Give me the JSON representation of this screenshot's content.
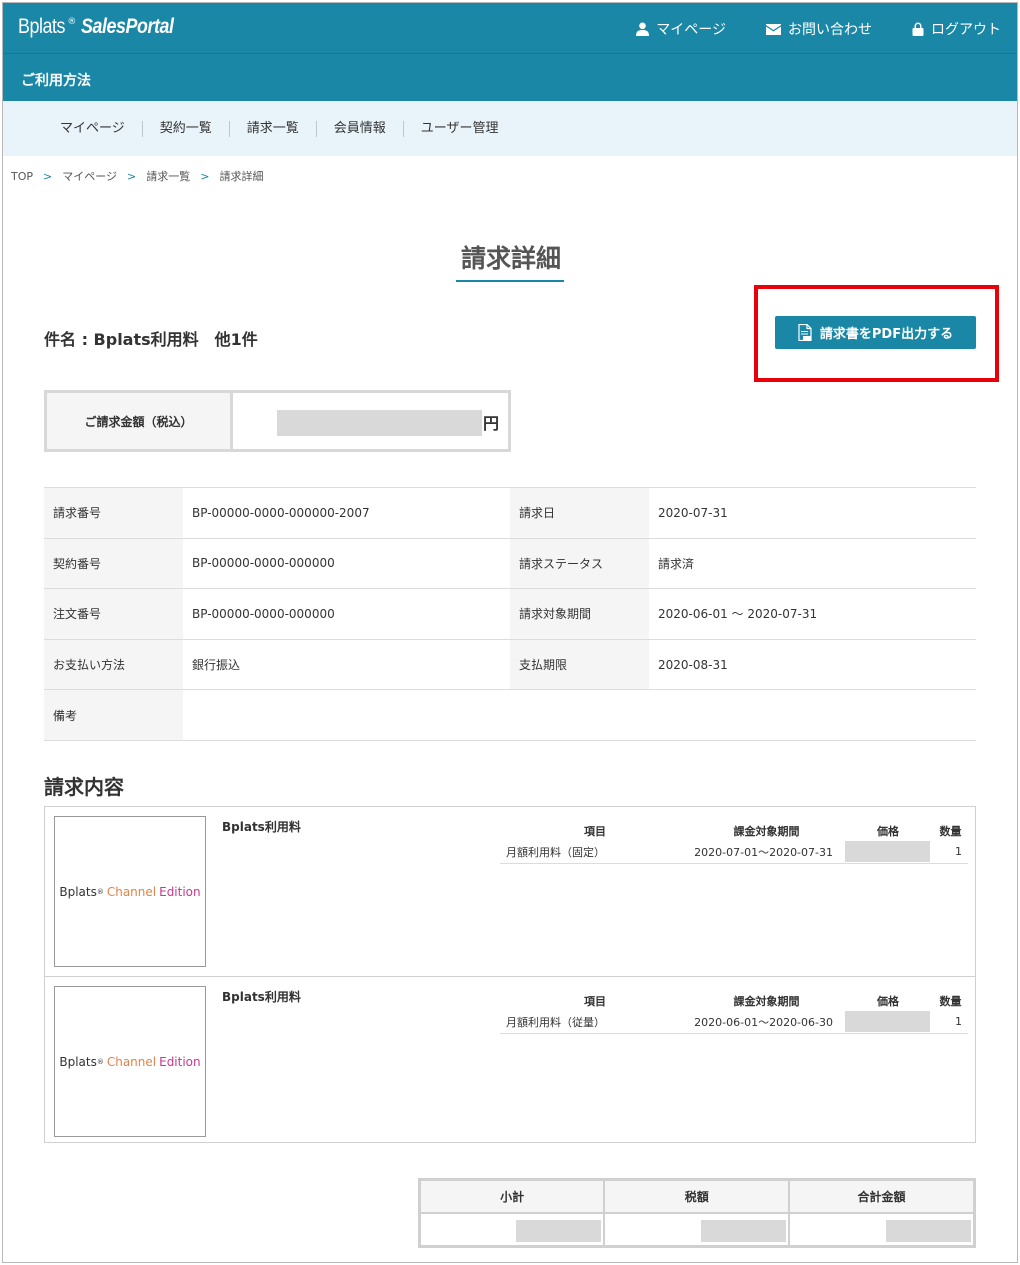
{
  "header": {
    "brand": "Bplats",
    "brand_mark": "®",
    "product": "SalesPortal",
    "nav": [
      {
        "label": "マイページ",
        "icon": "user-icon"
      },
      {
        "label": "お問い合わせ",
        "icon": "mail-icon"
      },
      {
        "label": "ログアウト",
        "icon": "lock-icon"
      }
    ],
    "help_label": "ご利用方法"
  },
  "menu": [
    "マイページ",
    "契約一覧",
    "請求一覧",
    "会員情報",
    "ユーザー管理"
  ],
  "breadcrumb": [
    "TOP",
    "マイページ",
    "請求一覧",
    "請求詳細"
  ],
  "page_title": "請求詳細",
  "subject": "件名 : Bplats利用料　他1件",
  "pdf_button_label": "請求書をPDF出力する",
  "amount": {
    "label": "ご請求金額（税込）",
    "currency": "円"
  },
  "details": [
    {
      "k1": "請求番号",
      "v1": "BP-00000-0000-000000-2007",
      "k2": "請求日",
      "v2": "2020-07-31"
    },
    {
      "k1": "契約番号",
      "v1": "BP-00000-0000-000000",
      "k2": "請求ステータス",
      "v2": "請求済"
    },
    {
      "k1": "注文番号",
      "v1": "BP-00000-0000-000000",
      "k2": "請求対象期間",
      "v2": "2020-06-01 ～ 2020-07-31"
    },
    {
      "k1": "お支払い方法",
      "v1": "銀行振込",
      "k2": "支払期限",
      "v2": "2020-08-31"
    },
    {
      "k1": "備考",
      "v1": "",
      "k2": "",
      "v2": ""
    }
  ],
  "section_title": "請求内容",
  "item_headers": {
    "item": "項目",
    "period": "課金対象期間",
    "price": "価格",
    "qty": "数量"
  },
  "products": [
    {
      "thumb": {
        "brand": "Bplats",
        "mark": "®",
        "word1": "Channel",
        "word2": "Edition"
      },
      "name": "Bplats利用料",
      "line": {
        "item": "月額利用料（固定）",
        "period": "2020-07-01～2020-07-31",
        "qty": "1"
      }
    },
    {
      "thumb": {
        "brand": "Bplats",
        "mark": "®",
        "word1": "Channel",
        "word2": "Edition"
      },
      "name": "Bplats利用料",
      "line": {
        "item": "月額利用料（従量）",
        "period": "2020-06-01～2020-06-30",
        "qty": "1"
      }
    }
  ],
  "totals_headers": [
    "小計",
    "税額",
    "合計金額"
  ],
  "colors": {
    "primary": "#1a87a6",
    "highlight": "#e8000b",
    "menu_bg": "#e9f3fa"
  }
}
